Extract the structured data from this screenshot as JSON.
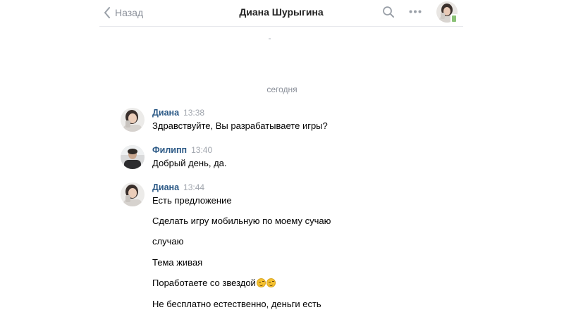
{
  "header": {
    "back_label": "Назад",
    "chat_title": "Диана Шурыгина",
    "back_icon": "chevron-left-icon",
    "search_icon": "search-icon",
    "more_icon": "more-dots-icon"
  },
  "date_divider": "сегодня",
  "messages": [
    {
      "author": "Диана",
      "time": "13:38",
      "lines": [
        "Здравствуйте, Вы разрабатываете игры?"
      ]
    },
    {
      "author": "Филипп",
      "time": "13:40",
      "lines": [
        "Добрый день, да."
      ]
    },
    {
      "author": "Диана",
      "time": "13:44",
      "lines": [
        "Есть предложение",
        "Сделать игру мобильную по моему сучаю",
        "случаю",
        "Тема живая",
        "Поработаете со звездой",
        "Не бесплатно естественно, деньги есть"
      ],
      "emoji_after_line_5": "smirk-emoji x2"
    }
  ],
  "colors": {
    "author_link": "#2a5885",
    "secondary_text": "#8a8f99",
    "divider": "#e7e8ec"
  }
}
